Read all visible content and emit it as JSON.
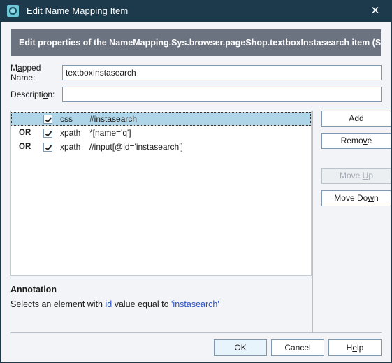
{
  "window": {
    "title": "Edit Name Mapping Item",
    "icon": "gear-icon",
    "close_icon": "close-icon",
    "titlebar_color": "#1d3a4c",
    "accent_color": "#6fc7d8"
  },
  "banner": {
    "text": "Edit properties of the NameMapping.Sys.browser.pageShop.textboxInstasearch item (Sys.B",
    "background": "#6b7280"
  },
  "fields": {
    "mapped_name": {
      "label_before": "M",
      "label_accel": "a",
      "label_after": "pped Name:",
      "value": "textboxInstasearch",
      "placeholder": ""
    },
    "description": {
      "label_before": "Descripti",
      "label_accel": "o",
      "label_after": "n:",
      "value": "",
      "placeholder": ""
    }
  },
  "selector_list": {
    "rows": [
      {
        "conjunction": "",
        "checked": true,
        "type": "css",
        "value": "#instasearch",
        "selected": true
      },
      {
        "conjunction": "OR",
        "checked": true,
        "type": "xpath",
        "value": "*[name='q']",
        "selected": false
      },
      {
        "conjunction": "OR",
        "checked": true,
        "type": "xpath",
        "value": "//input[@id='instasearch']",
        "selected": false
      }
    ],
    "selected_row_color": "#aed6e8"
  },
  "side_buttons": [
    {
      "name": "add",
      "before": "A",
      "accel": "d",
      "after": "d",
      "disabled": false
    },
    {
      "name": "remove",
      "before": "Remo",
      "accel": "v",
      "after": "e",
      "disabled": false
    },
    {
      "name": "move-up",
      "before": "Move ",
      "accel": "U",
      "after": "p",
      "disabled": true
    },
    {
      "name": "move-down",
      "before": "Move Do",
      "accel": "w",
      "after": "n",
      "disabled": false
    }
  ],
  "annotation": {
    "title": "Annotation",
    "part1": "Selects an element with ",
    "highlight1": "id",
    "part2": " value equal to ",
    "highlight2": "'instasearch'",
    "highlight_color": "#2952c8"
  },
  "footer_buttons": {
    "ok": {
      "label": "OK",
      "default": true
    },
    "cancel": {
      "label": "Cancel",
      "default": false
    },
    "help": {
      "before": "H",
      "accel": "e",
      "after": "lp",
      "default": false
    }
  }
}
